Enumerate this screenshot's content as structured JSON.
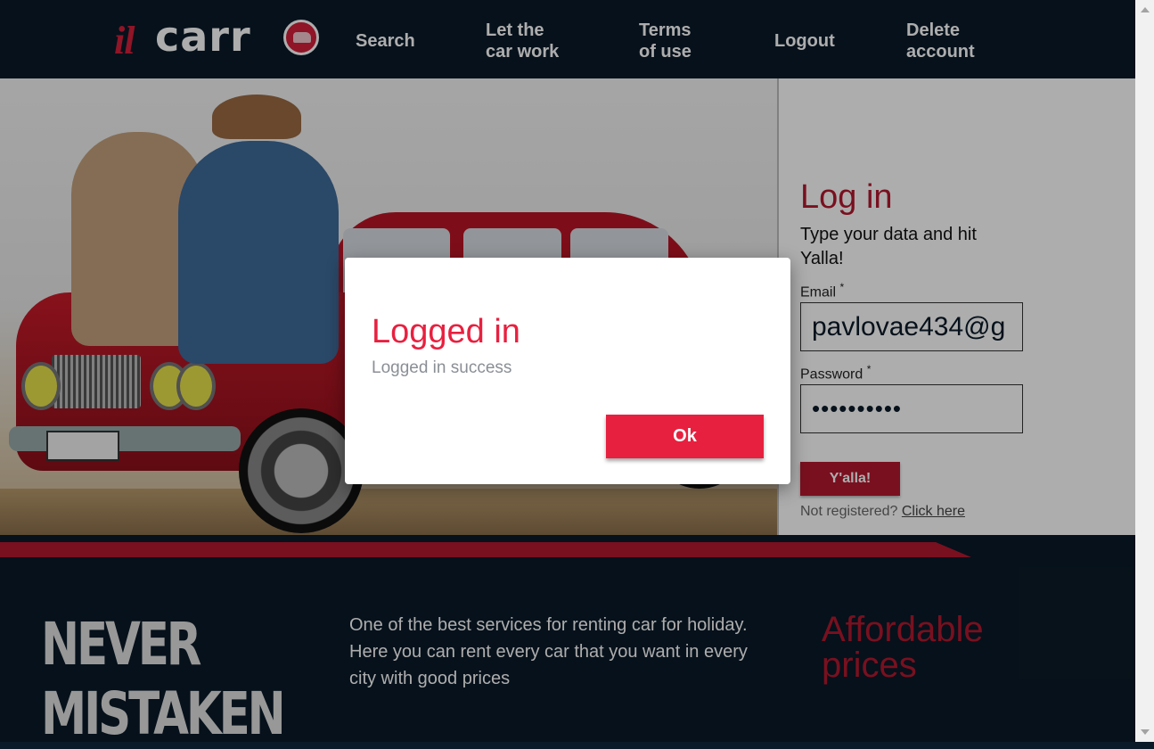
{
  "header": {
    "logo": {
      "il": "il",
      "carr": "carr"
    },
    "nav": [
      {
        "label": "Search"
      },
      {
        "label": "Let the\ncar work"
      },
      {
        "label": "Terms\nof use"
      },
      {
        "label": "Logout"
      },
      {
        "label": "Delete\naccount"
      }
    ]
  },
  "login": {
    "title": "Log in",
    "subtitle": "Type your data and hit Yalla!",
    "email_label": "Email",
    "email_value": "pavlovae434@g",
    "password_label": "Password",
    "password_value": "••••••••••",
    "required_mark": "*",
    "submit_label": "Y'alla!",
    "not_registered": "Not registered?",
    "click_here": "Click here"
  },
  "footer": {
    "slogan": "NEVER\nMISTAKEN",
    "description": "One of the best services for renting car for holiday. Here you can rent every car that you want in every city with good prices",
    "affordable": "Affordable prices"
  },
  "dialog": {
    "title": "Logged in",
    "message": "Logged in success",
    "ok_label": "Ok"
  },
  "colors": {
    "navy": "#0a1a28",
    "brand_red": "#b3182f",
    "dialog_red": "#e8203f"
  }
}
